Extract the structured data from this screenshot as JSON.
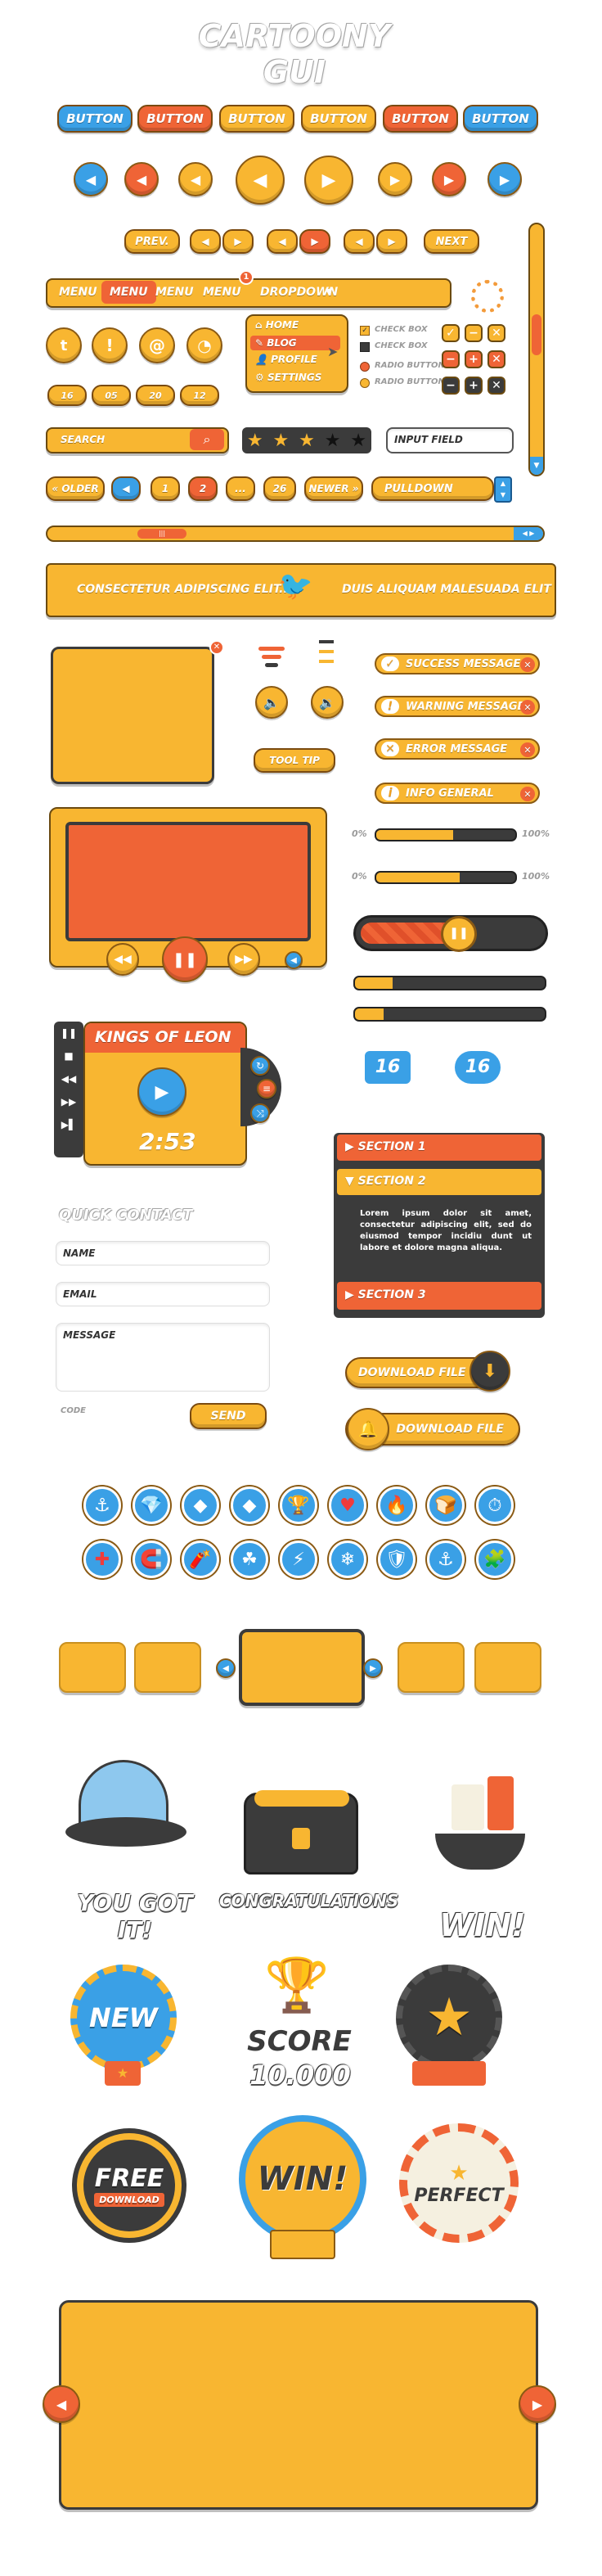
{
  "title": "CARTOONY GUI",
  "colors": {
    "yellow": "#f8b631",
    "orange": "#ef6436",
    "blue": "#3aa0e6",
    "dark": "#3b3b3b"
  },
  "buttons": [
    "BUTTON",
    "BUTTON",
    "BUTTON",
    "BUTTON",
    "BUTTON",
    "BUTTON"
  ],
  "pager1": {
    "prev": "PREV.",
    "next": "NEXT"
  },
  "menu": {
    "items": [
      "MENU",
      "MENU",
      "MENU",
      "MENU"
    ],
    "dropdown": "DROPDOWN",
    "badge": "1"
  },
  "dropdown_menu": [
    "HOME",
    "BLOG",
    "PROFILE",
    "SETTINGS"
  ],
  "checkboxes": [
    "CHECK BOX",
    "CHECK BOX",
    "RADIO BUTTON",
    "RADIO BUTTON"
  ],
  "date": [
    "16",
    "05",
    "20",
    "12"
  ],
  "search": {
    "placeholder": "SEARCH"
  },
  "rating": {
    "stars": 5,
    "filled": 3
  },
  "input_field": "INPUT FIELD",
  "pagination": {
    "older": "« OLDER",
    "pages": [
      "1",
      "2",
      "...",
      "26"
    ],
    "newer": "NEWER »",
    "pulldown": "PULLDOWN"
  },
  "banner": {
    "left": "CONSECTETUR ADIPISCING ELIT...",
    "right": "DUIS ALIQUAM MALESUADA ELIT"
  },
  "tooltip": "TOOL TIP",
  "messages": [
    "SUCCESS MESSAGE",
    "WARNING MESSAGE",
    "ERROR MESSAGE",
    "INFO GENERAL"
  ],
  "progress": [
    {
      "left": "0%",
      "right": "100%",
      "value": 0.55
    },
    {
      "left": "0%",
      "right": "100%",
      "value": 0.6
    }
  ],
  "player": {
    "artist": "KINGS OF LEON",
    "time": "2:53"
  },
  "counters": [
    "16",
    "16"
  ],
  "accordion": {
    "sections": [
      "SECTION 1",
      "SECTION 2",
      "SECTION 3"
    ],
    "body": "Lorem ipsum dolor sit amet, consectetur adipiscing elit, sed do eiusmod tempor incidiu dunt ut labore et dolore magna aliqua."
  },
  "contact": {
    "title": "QUICK CONTACT",
    "name": "NAME",
    "email": "EMAIL",
    "message": "MESSAGE",
    "code": "CODE",
    "send": "SEND"
  },
  "download": [
    "DOWNLOAD FILE",
    "DOWNLOAD FILE"
  ],
  "awards": {
    "you_got_it": "YOU GOT IT!",
    "congrats": "CONGRATULATIONS",
    "win": "WIN!",
    "new": "NEW",
    "score": "SCORE",
    "score_val": "10.000",
    "free": "FREE",
    "download": "DOWNLOAD",
    "win2": "WIN!",
    "perfect": "PERFECT"
  }
}
